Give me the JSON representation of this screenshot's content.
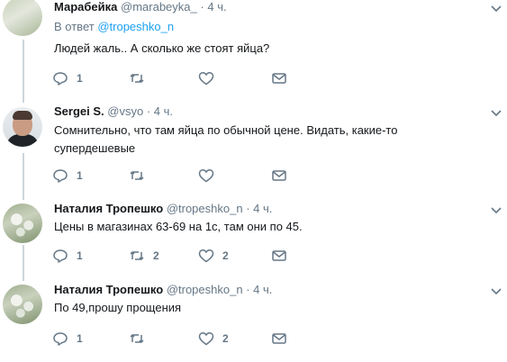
{
  "tweets": [
    {
      "name": "Марабейка",
      "handle": "@marabeyka_",
      "dot": "·",
      "time": "4 ч.",
      "reply_prefix": "В ответ",
      "reply_mention": "@tropeshko_n",
      "text": "Людей жаль.. А сколько же стоят яйца?",
      "replies": "1",
      "retweets": "",
      "likes": ""
    },
    {
      "name": "Sergei S.",
      "handle": "@vsyo",
      "dot": "·",
      "time": "4 ч.",
      "text": "Сомнительно, что там яйца по обычной цене. Видать, какие-то супердешевые",
      "replies": "1",
      "retweets": "",
      "likes": ""
    },
    {
      "name": "Наталия Тропешко",
      "handle": "@tropeshko_n",
      "dot": "·",
      "time": "4 ч.",
      "text": "Цены в магазинах 63-69 на 1с, там они по 45.",
      "replies": "1",
      "retweets": "2",
      "likes": "2"
    },
    {
      "name": "Наталия Тропешко",
      "handle": "@tropeshko_n",
      "dot": "·",
      "time": "4 ч.",
      "text": "По 49,прошу прощения",
      "replies": "1",
      "retweets": "",
      "likes": "2"
    }
  ],
  "icons": {
    "reply": "reply-icon",
    "retweet": "retweet-icon",
    "like": "heart-icon",
    "dm": "envelope-icon",
    "more": "chevron-down-icon"
  },
  "colors": {
    "text": "#14171a",
    "muted": "#657786",
    "link": "#1da1f2",
    "thread": "#ccd6dd"
  }
}
